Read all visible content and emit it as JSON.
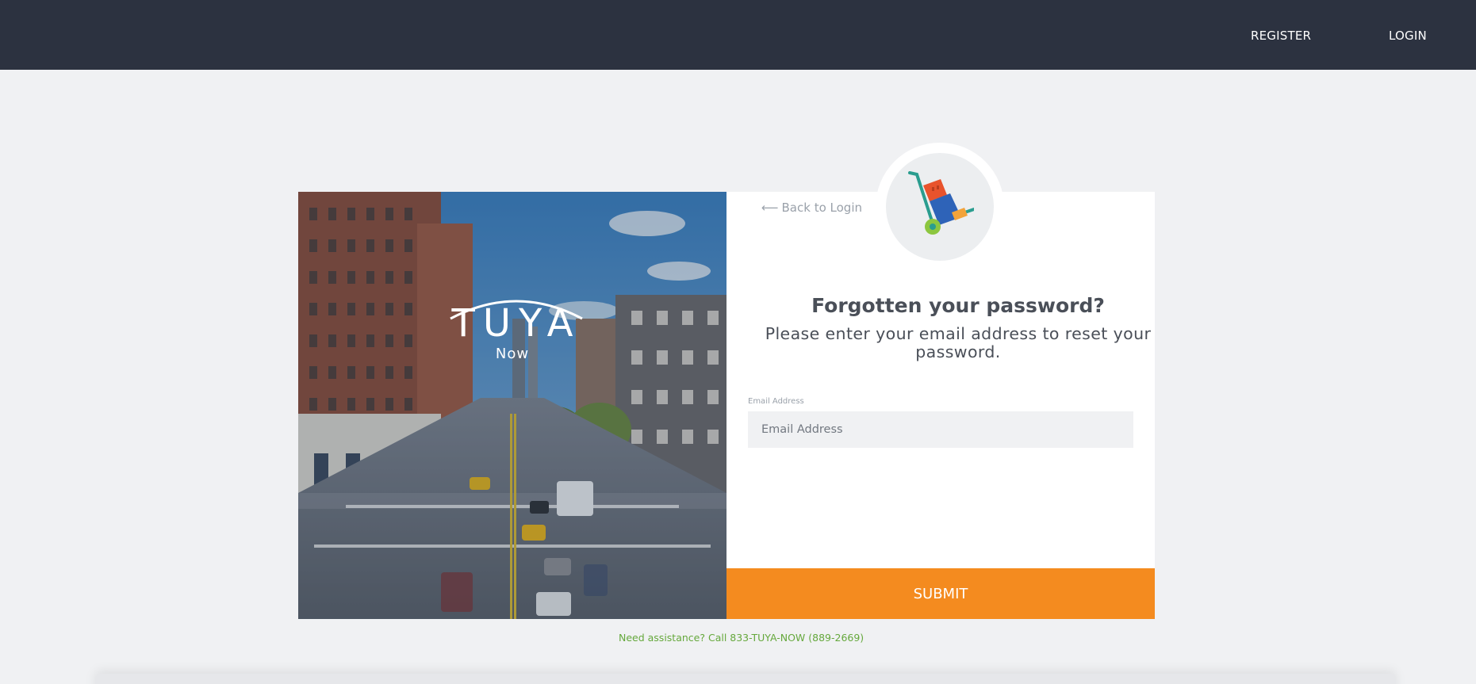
{
  "nav": {
    "register_label": "REGISTER",
    "login_label": "LOGIN"
  },
  "brand": {
    "logo_word": "TUYA",
    "logo_sub": "Now"
  },
  "panel": {
    "back_link_label": "Back to Login",
    "title": "Forgotten your password?",
    "subtitle": "Please enter your email address to reset your password.",
    "email_label": "Email Address",
    "email_placeholder": "Email Address",
    "email_value": "",
    "submit_label": "SUBMIT"
  },
  "footer": {
    "assistance_text": "Need assistance? Call 833-TUYA-NOW (889-2669)"
  },
  "colors": {
    "topbar": "#2c3240",
    "submit": "#f48b1f",
    "assist_link": "#65a83c",
    "background": "#f0f1f3"
  },
  "icons": {
    "back": "arrow-left-icon",
    "badge": "hand-truck-icon"
  }
}
